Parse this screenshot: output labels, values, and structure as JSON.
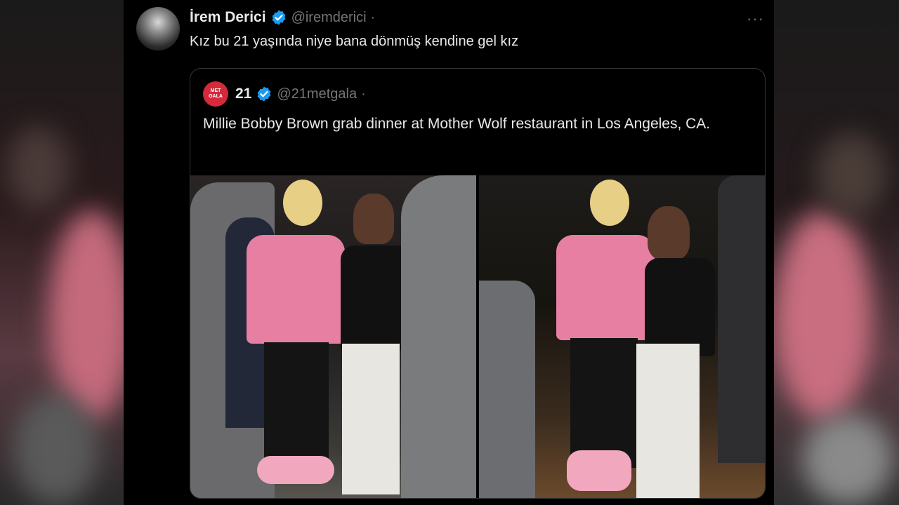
{
  "tweet": {
    "author_name": "İrem Derici",
    "author_handle": "@iremderici",
    "separator": "·",
    "more_label": "···",
    "text": "Kız bu 21 yaşında niye bana dönmüş kendine gel kız"
  },
  "quoted": {
    "avatar_text": "MET GALA",
    "author_name": "21",
    "author_handle": "@21metgala",
    "separator": "·",
    "text": "Millie Bobby Brown grab dinner at Mother Wolf restaurant in Los Angeles, CA."
  },
  "icons": {
    "verified": "verified-badge-icon",
    "more": "more-options-icon"
  },
  "colors": {
    "background": "#000000",
    "text_primary": "#e7e9ea",
    "text_secondary": "#71767b",
    "verified_blue": "#1d9bf0",
    "border": "#333639"
  }
}
